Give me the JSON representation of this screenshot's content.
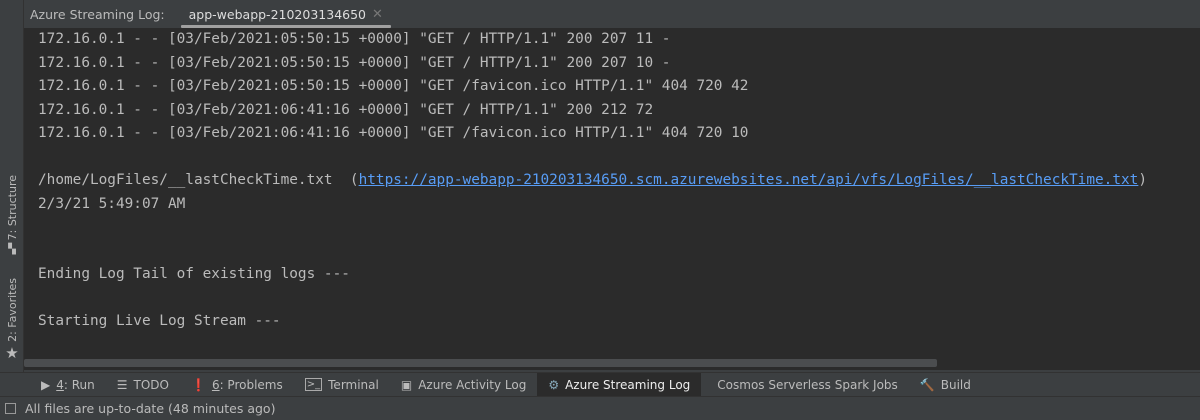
{
  "header": {
    "title": "Azure Streaming Log:",
    "tab": "app-webapp-210203134650"
  },
  "sidebar": {
    "structure": "7: Structure",
    "favorites": "2: Favorites"
  },
  "log": {
    "lines": [
      "172.16.0.1 - - [03/Feb/2021:05:50:15 +0000] \"GET / HTTP/1.1\" 200 207 11 -",
      "172.16.0.1 - - [03/Feb/2021:05:50:15 +0000] \"GET / HTTP/1.1\" 200 207 10 -",
      "172.16.0.1 - - [03/Feb/2021:05:50:15 +0000] \"GET /favicon.ico HTTP/1.1\" 404 720 42",
      "172.16.0.1 - - [03/Feb/2021:06:41:16 +0000] \"GET / HTTP/1.1\" 200 212 72",
      "172.16.0.1 - - [03/Feb/2021:06:41:16 +0000] \"GET /favicon.ico HTTP/1.1\" 404 720 10"
    ],
    "file_path": "/home/LogFiles/__lastCheckTime.txt  (",
    "file_link": "https://app-webapp-210203134650.scm.azurewebsites.net/api/vfs/LogFiles/__lastCheckTime.txt",
    "file_close": ")",
    "check_time": "2/3/21 5:49:07 AM",
    "ending": "Ending Log Tail of existing logs ---",
    "starting": "Starting Live Log Stream ---"
  },
  "toolwindows": [
    {
      "key": "4",
      "label": ": Run"
    },
    {
      "key": "",
      "label": "TODO"
    },
    {
      "key": "6",
      "label": ": Problems"
    },
    {
      "key": "",
      "label": "Terminal"
    },
    {
      "key": "",
      "label": "Azure Activity Log"
    },
    {
      "key": "",
      "label": "Azure Streaming Log"
    },
    {
      "key": "",
      "label": "Cosmos Serverless Spark Jobs"
    },
    {
      "key": "",
      "label": "Build"
    }
  ],
  "status": {
    "text": "All files are up-to-date (48 minutes ago)"
  }
}
